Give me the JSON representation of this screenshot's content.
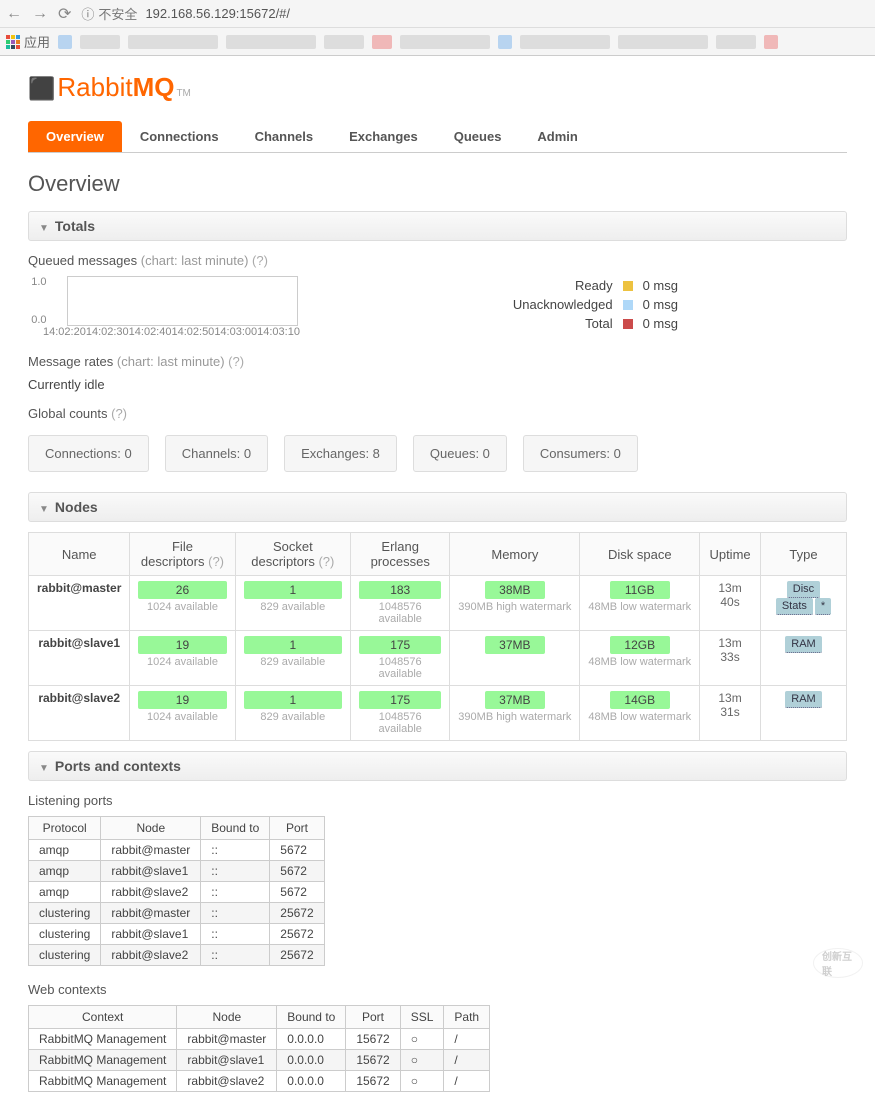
{
  "browser": {
    "insecure_label": "不安全",
    "url": "192.168.56.129:15672/#/",
    "apps_label": "应用"
  },
  "logo": {
    "text_a": "Rabbit",
    "text_b": "MQ",
    "tm": "TM"
  },
  "tabs": [
    "Overview",
    "Connections",
    "Channels",
    "Exchanges",
    "Queues",
    "Admin"
  ],
  "page_title": "Overview",
  "sections": {
    "totals": "Totals",
    "nodes": "Nodes",
    "ports": "Ports and contexts"
  },
  "queued_messages": {
    "title": "Queued messages",
    "sub": "(chart: last minute)",
    "y": [
      "1.0",
      "0.0"
    ],
    "x": [
      "14:02:20",
      "14:02:30",
      "14:02:40",
      "14:02:50",
      "14:03:00",
      "14:03:10"
    ],
    "legend": [
      {
        "label": "Ready",
        "val": "0 msg",
        "color": "y"
      },
      {
        "label": "Unacknowledged",
        "val": "0 msg",
        "color": "b"
      },
      {
        "label": "Total",
        "val": "0 msg",
        "color": "r"
      }
    ]
  },
  "chart_data": {
    "type": "line",
    "title": "Queued messages",
    "xlabel": "",
    "ylabel": "",
    "ylim": [
      0,
      1
    ],
    "x": [
      "14:02:20",
      "14:02:30",
      "14:02:40",
      "14:02:50",
      "14:03:00",
      "14:03:10"
    ],
    "series": [
      {
        "name": "Ready",
        "values": [
          0,
          0,
          0,
          0,
          0,
          0
        ]
      },
      {
        "name": "Unacknowledged",
        "values": [
          0,
          0,
          0,
          0,
          0,
          0
        ]
      },
      {
        "name": "Total",
        "values": [
          0,
          0,
          0,
          0,
          0,
          0
        ]
      }
    ]
  },
  "message_rates": {
    "title": "Message rates",
    "sub": "(chart: last minute)",
    "idle": "Currently idle"
  },
  "global_counts": {
    "title": "Global counts",
    "items": [
      {
        "label": "Connections:",
        "val": "0"
      },
      {
        "label": "Channels:",
        "val": "0"
      },
      {
        "label": "Exchanges:",
        "val": "8"
      },
      {
        "label": "Queues:",
        "val": "0"
      },
      {
        "label": "Consumers:",
        "val": "0"
      }
    ]
  },
  "nodes_table": {
    "headers": [
      "Name",
      "File descriptors",
      "Socket descriptors",
      "Erlang processes",
      "Memory",
      "Disk space",
      "Uptime",
      "Type"
    ],
    "rows": [
      {
        "name": "rabbit@master",
        "fd": "26",
        "fd_avail": "1024 available",
        "sd": "1",
        "sd_avail": "829 available",
        "ep": "183",
        "ep_avail": "1048576 available",
        "mem": "38MB",
        "mem_note": "390MB high watermark",
        "disk": "11GB",
        "disk_note": "48MB low watermark",
        "uptime": "13m 40s",
        "tags": [
          "Disc",
          "Stats",
          "*"
        ]
      },
      {
        "name": "rabbit@slave1",
        "fd": "19",
        "fd_avail": "1024 available",
        "sd": "1",
        "sd_avail": "829 available",
        "ep": "175",
        "ep_avail": "1048576 available",
        "mem": "37MB",
        "mem_note": "",
        "disk": "12GB",
        "disk_note": "48MB low watermark",
        "uptime": "13m 33s",
        "tags": [
          "RAM"
        ]
      },
      {
        "name": "rabbit@slave2",
        "fd": "19",
        "fd_avail": "1024 available",
        "sd": "1",
        "sd_avail": "829 available",
        "ep": "175",
        "ep_avail": "1048576 available",
        "mem": "37MB",
        "mem_note": "390MB high watermark",
        "disk": "14GB",
        "disk_note": "48MB low watermark",
        "uptime": "13m 31s",
        "tags": [
          "RAM"
        ]
      }
    ]
  },
  "ports": {
    "listening_title": "Listening ports",
    "headers": [
      "Protocol",
      "Node",
      "Bound to",
      "Port"
    ],
    "rows": [
      {
        "proto": "amqp",
        "node": "rabbit@master",
        "bound": "::",
        "port": "5672"
      },
      {
        "proto": "amqp",
        "node": "rabbit@slave1",
        "bound": "::",
        "port": "5672"
      },
      {
        "proto": "amqp",
        "node": "rabbit@slave2",
        "bound": "::",
        "port": "5672"
      },
      {
        "proto": "clustering",
        "node": "rabbit@master",
        "bound": "::",
        "port": "25672"
      },
      {
        "proto": "clustering",
        "node": "rabbit@slave1",
        "bound": "::",
        "port": "25672"
      },
      {
        "proto": "clustering",
        "node": "rabbit@slave2",
        "bound": "::",
        "port": "25672"
      }
    ]
  },
  "web_contexts": {
    "title": "Web contexts",
    "headers": [
      "Context",
      "Node",
      "Bound to",
      "Port",
      "SSL",
      "Path"
    ],
    "rows": [
      {
        "ctx": "RabbitMQ Management",
        "node": "rabbit@master",
        "bound": "0.0.0.0",
        "port": "15672",
        "ssl": "○",
        "path": "/"
      },
      {
        "ctx": "RabbitMQ Management",
        "node": "rabbit@slave1",
        "bound": "0.0.0.0",
        "port": "15672",
        "ssl": "○",
        "path": "/"
      },
      {
        "ctx": "RabbitMQ Management",
        "node": "rabbit@slave2",
        "bound": "0.0.0.0",
        "port": "15672",
        "ssl": "○",
        "path": "/"
      }
    ]
  },
  "help": "(?)",
  "watermark": "创新互联"
}
